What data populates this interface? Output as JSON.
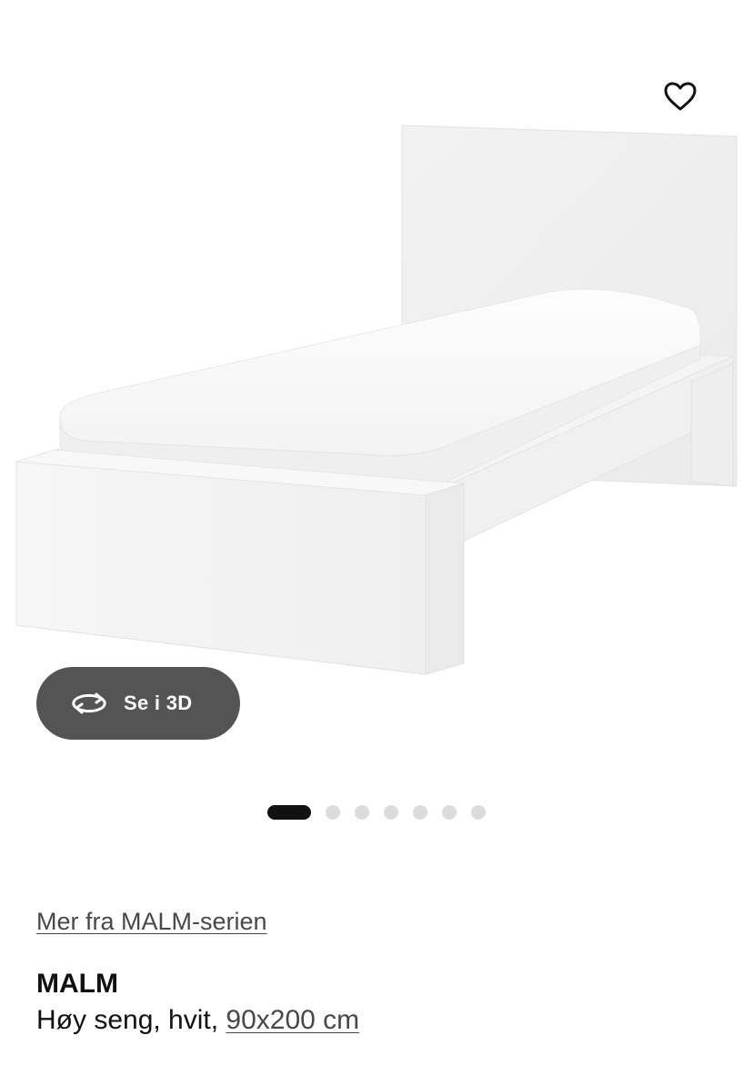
{
  "product_image": {
    "icon": "bed-product-image"
  },
  "favorite": {
    "icon": "heart-outline-icon"
  },
  "view_3d": {
    "label": "Se i 3D",
    "icon": "rotate-3d-icon",
    "background": "#545454"
  },
  "carousel": {
    "total": 7,
    "active_index": 0
  },
  "series_link": {
    "label": "Mer fra MALM-serien"
  },
  "product": {
    "name": "MALM",
    "description": "Høy seng, hvit, ",
    "size": "90x200 cm"
  },
  "colors": {
    "text": "#111111",
    "link": "#484848",
    "dot_active": "#111111",
    "dot_inactive": "#dcdcdc"
  }
}
